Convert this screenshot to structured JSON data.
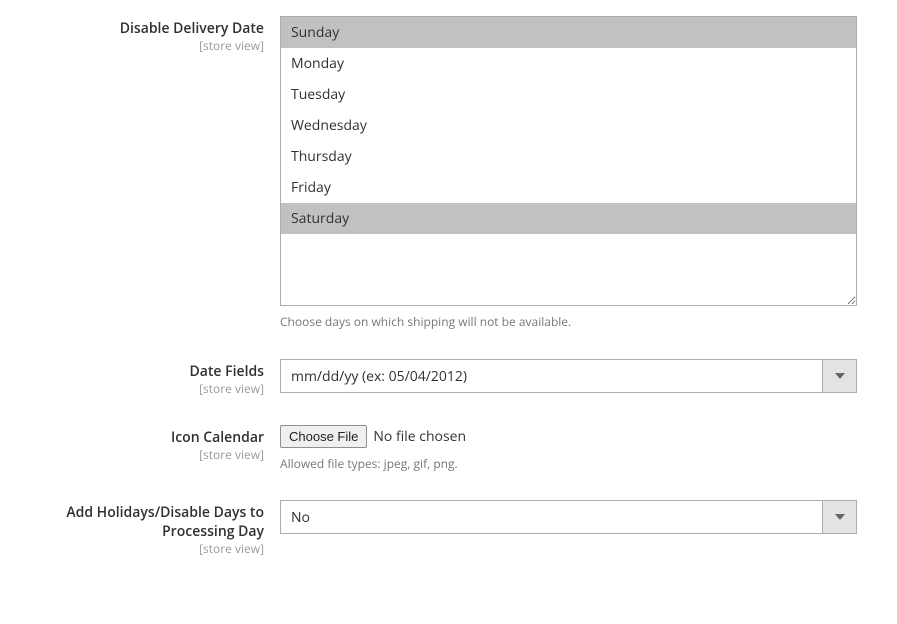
{
  "scope_label": "[store view]",
  "disable_delivery": {
    "label": "Disable Delivery Date",
    "options": [
      {
        "label": "Sunday",
        "selected": true
      },
      {
        "label": "Monday",
        "selected": false
      },
      {
        "label": "Tuesday",
        "selected": false
      },
      {
        "label": "Wednesday",
        "selected": false
      },
      {
        "label": "Thursday",
        "selected": false
      },
      {
        "label": "Friday",
        "selected": false
      },
      {
        "label": "Saturday",
        "selected": true
      }
    ],
    "help": "Choose days on which shipping will not be available."
  },
  "date_fields": {
    "label": "Date Fields",
    "value": "mm/dd/yy (ex: 05/04/2012)"
  },
  "icon_calendar": {
    "label": "Icon Calendar",
    "button": "Choose File",
    "status": "No file chosen",
    "help": "Allowed file types: jpeg, gif, png."
  },
  "holidays": {
    "label": "Add Holidays/Disable Days to Processing Day",
    "value": "No"
  }
}
